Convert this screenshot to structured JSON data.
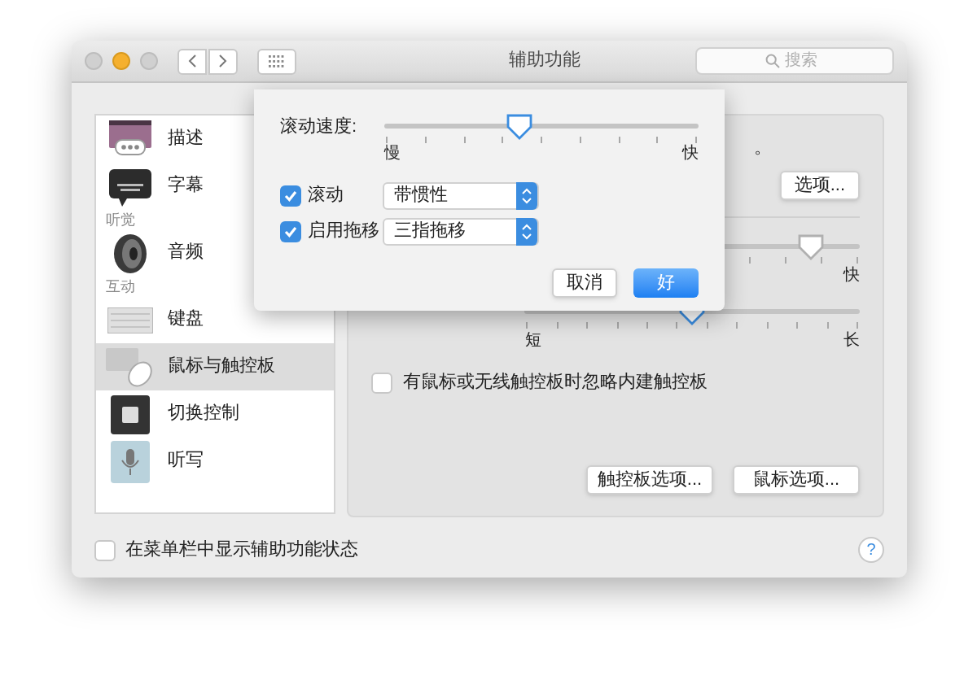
{
  "window": {
    "title": "辅助功能",
    "search": {
      "placeholder": "搜索"
    }
  },
  "sidebar": {
    "items": [
      {
        "kind": "item",
        "label": "描述",
        "selected": false
      },
      {
        "kind": "item",
        "label": "字幕",
        "selected": false
      },
      {
        "kind": "header",
        "label": "听觉"
      },
      {
        "kind": "item",
        "label": "音频",
        "selected": false
      },
      {
        "kind": "header",
        "label": "互动"
      },
      {
        "kind": "item",
        "label": "键盘",
        "selected": false
      },
      {
        "kind": "item",
        "label": "鼠标与触控板",
        "selected": true
      },
      {
        "kind": "item",
        "label": "切换控制",
        "selected": false
      },
      {
        "kind": "item",
        "label": "听写",
        "selected": false
      }
    ]
  },
  "content": {
    "partial_text": "。",
    "options_button": "选项...",
    "slider_1": {
      "level": 0.85,
      "max_label": "快"
    },
    "slider_2": {
      "level": 0.5,
      "min_label": "短",
      "max_label": "长"
    },
    "ignore_checkbox": {
      "label": "有鼠标或无线触控板时忽略内建触控板",
      "checked": false
    },
    "buttons": [
      "触控板选项...",
      "鼠标选项..."
    ]
  },
  "sheet": {
    "speed_label": "滚动速度:",
    "speed": {
      "level": 0.43,
      "min_label": "慢",
      "max_label": "快"
    },
    "rows": [
      {
        "label": "滚动",
        "checked": true,
        "value": "带惯性"
      },
      {
        "label": "启用拖移",
        "checked": true,
        "value": "三指拖移"
      }
    ],
    "cancel": "取消",
    "ok": "好"
  },
  "status_checkbox": {
    "label": "在菜单栏中显示辅助功能状态",
    "checked": false
  },
  "help": "?"
}
